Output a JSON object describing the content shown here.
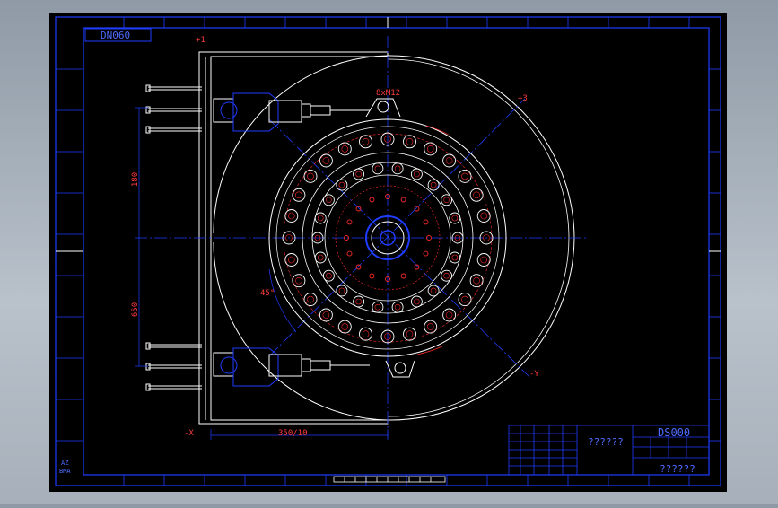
{
  "drawing": {
    "code_box": "DN060",
    "title_block": {
      "name_center": "??????",
      "drawing_number": "DS000",
      "bottom_right": "??????"
    },
    "dimensions": {
      "left_upper": "180",
      "left_lower": "650",
      "bottom_width": "350/10",
      "top_bolt": "8xM12",
      "angle": "45°"
    },
    "axis_marks": {
      "top_left": "+1",
      "bottom_left": "-X",
      "top_right": "+3",
      "bottom_right": "-Y"
    },
    "margin_codes": [
      "AZ",
      "BMA"
    ]
  },
  "colors": {
    "background": "#000000",
    "frame": "#1f3cff",
    "geometry": "#ffffff",
    "center_lines": "#1f3cff",
    "dimension": "#ff2a2a"
  }
}
